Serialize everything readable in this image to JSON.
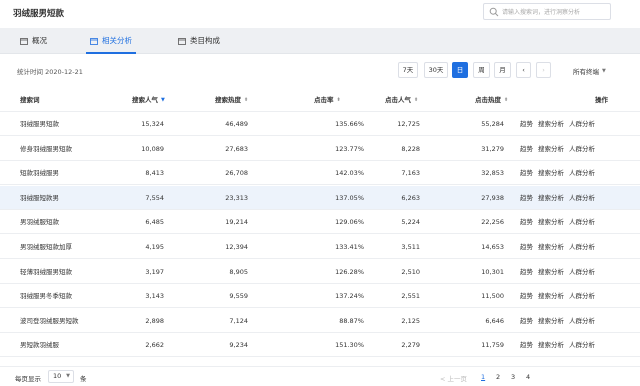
{
  "header": {
    "title": "羽绒服男短款",
    "search_placeholder": "请输入搜索词，进行洞察分析"
  },
  "tabs": [
    {
      "label": "概况"
    },
    {
      "label": "相关分析"
    },
    {
      "label": "类目构成"
    }
  ],
  "toolbar": {
    "stat_time": "统计时间 2020-12-21",
    "periods": [
      "7天",
      "30天",
      "日",
      "周",
      "月"
    ],
    "active_period": "日",
    "prev": "‹",
    "next": "›",
    "terminal": "所有终端"
  },
  "table": {
    "headers": [
      "搜索词",
      "搜索人气",
      "搜索热度",
      "点击率",
      "点击人气",
      "点击热度",
      "操作"
    ],
    "actions": [
      "趋势",
      "搜索分析",
      "人群分析"
    ],
    "rows": [
      [
        "羽绒服男短款",
        "15,324",
        "46,489",
        "135.66%",
        "12,725",
        "55,284"
      ],
      [
        "修身羽绒服男短款",
        "10,089",
        "27,683",
        "123.77%",
        "8,228",
        "31,279"
      ],
      [
        "短款羽绒服男",
        "8,413",
        "26,708",
        "142.03%",
        "7,163",
        "32,853"
      ],
      [
        "羽绒服短款男",
        "7,554",
        "23,313",
        "137.05%",
        "6,263",
        "27,938"
      ],
      [
        "男羽绒服短款",
        "6,485",
        "19,214",
        "129.06%",
        "5,224",
        "22,256"
      ],
      [
        "男羽绒服短款加厚",
        "4,195",
        "12,394",
        "133.41%",
        "3,511",
        "14,653"
      ],
      [
        "轻薄羽绒服男短款",
        "3,197",
        "8,905",
        "126.28%",
        "2,510",
        "10,301"
      ],
      [
        "羽绒服男冬季短款",
        "3,143",
        "9,559",
        "137.24%",
        "2,551",
        "11,500"
      ],
      [
        "波司登羽绒服男短款",
        "2,898",
        "7,124",
        "88.87%",
        "2,125",
        "6,646"
      ],
      [
        "男短款羽绒服",
        "2,662",
        "9,234",
        "151.30%",
        "2,279",
        "11,759"
      ]
    ]
  },
  "footer": {
    "per_page_label": "每页显示",
    "per_page_value": "10",
    "unit": "条",
    "prev_page": "< 上一页",
    "pages": [
      "1",
      "2",
      "3",
      "4"
    ]
  }
}
